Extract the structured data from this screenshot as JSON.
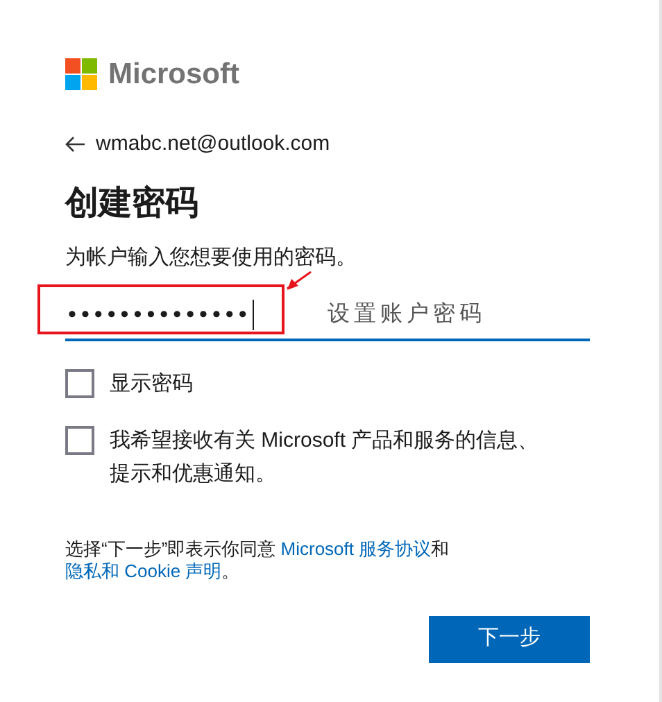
{
  "brand": "Microsoft",
  "account": "wmabc.net@outlook.com",
  "heading": "创建密码",
  "subtitle": "为帐户输入您想要使用的密码。",
  "password": {
    "value": "••••••••••••••",
    "focused": true
  },
  "annotation": {
    "text": "设置账户密码"
  },
  "checkboxes": [
    {
      "label": "显示密码",
      "checked": false
    },
    {
      "label": "我希望接收有关 Microsoft 产品和服务的信息、提示和优惠通知。",
      "checked": false
    }
  ],
  "legal": [
    {
      "kind": "text",
      "text": "选择“下一步”即表示你同意 "
    },
    {
      "kind": "link",
      "text": "Microsoft 服务协议"
    },
    {
      "kind": "text",
      "text": "和"
    },
    {
      "kind": "link",
      "text": "隐私和 Cookie 声明"
    },
    {
      "kind": "text",
      "text": "。"
    }
  ],
  "button": "下一步"
}
